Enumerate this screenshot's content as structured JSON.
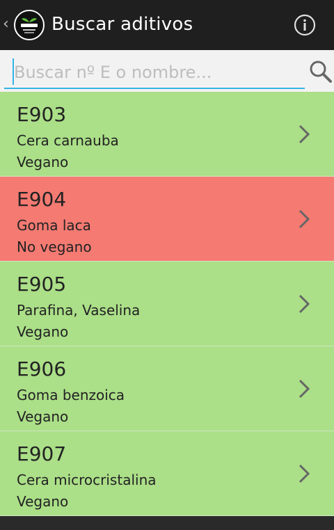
{
  "header": {
    "title": "Buscar aditivos",
    "back_glyph": "‹",
    "logo_icon": "vegan-logo-icon",
    "info_icon": "info-icon"
  },
  "search": {
    "placeholder": "Buscar nº E o nombre...",
    "value": ""
  },
  "colors": {
    "vegan": "#abdf88",
    "non_vegan": "#f47a72",
    "accent": "#33b5e5"
  },
  "items": [
    {
      "code": "E903",
      "name": "Cera carnauba",
      "status": "Vegano",
      "vegan": true
    },
    {
      "code": "E904",
      "name": "Goma laca",
      "status": "No vegano",
      "vegan": false
    },
    {
      "code": "E905",
      "name": "Parafina, Vaselina",
      "status": "Vegano",
      "vegan": true
    },
    {
      "code": "E906",
      "name": "Goma benzoica",
      "status": "Vegano",
      "vegan": true
    },
    {
      "code": "E907",
      "name": "Cera microcristalina",
      "status": "Vegano",
      "vegan": true
    }
  ]
}
